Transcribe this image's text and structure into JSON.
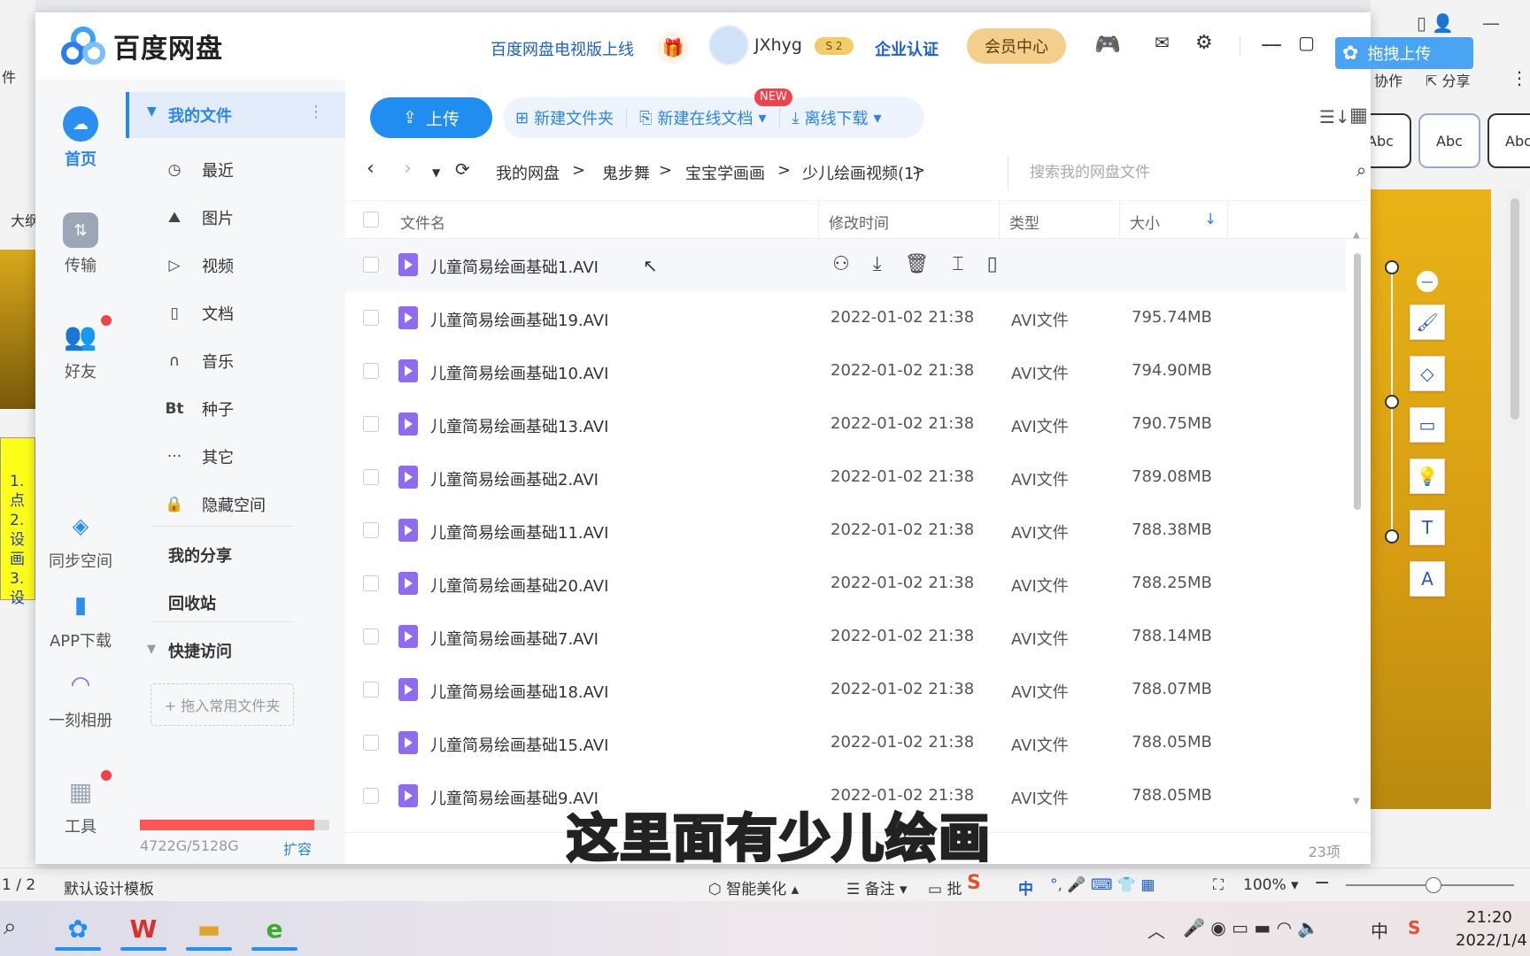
{
  "background_app": {
    "left_labels": [
      "件",
      "大纲"
    ],
    "left_box_lines": [
      "1.点",
      "2.设",
      "画",
      "3.设"
    ],
    "toolbar_right": {
      "collab": "协作",
      "share": "分享"
    },
    "style_samples": [
      "Abc",
      "Abc",
      "Abc"
    ],
    "status": {
      "page": "1 / 2",
      "template": "默认设计模板",
      "beautify": "智能美化",
      "notes": "备注",
      "batch": "批",
      "zoom": "100%"
    }
  },
  "taskbar": {
    "time": "21:20",
    "date": "2022/1/4",
    "ime": [
      "中",
      "中"
    ]
  },
  "baidu": {
    "logo": "百度网盘",
    "tv_link": "百度网盘电视版上线",
    "username": "JXhyg",
    "enterprise": "企业认证",
    "vip_center": "会员中心",
    "drag_upload": "拖拽上传",
    "rail": [
      {
        "label": "首页",
        "icon": "cloud-icon"
      },
      {
        "label": "传输",
        "icon": "transfer-icon"
      },
      {
        "label": "好友",
        "icon": "friends-icon"
      },
      {
        "label": "同步空间",
        "icon": "sync-icon"
      },
      {
        "label": "APP下载",
        "icon": "phone-icon"
      },
      {
        "label": "一刻相册",
        "icon": "album-icon"
      },
      {
        "label": "工具",
        "icon": "tools-icon"
      }
    ],
    "nav": {
      "my_files": "我的文件",
      "items": [
        {
          "label": "最近",
          "icon": "clock-icon"
        },
        {
          "label": "图片",
          "icon": "image-icon"
        },
        {
          "label": "视频",
          "icon": "play-icon"
        },
        {
          "label": "文档",
          "icon": "doc-icon"
        },
        {
          "label": "音乐",
          "icon": "headphone-icon"
        },
        {
          "label": "种子",
          "icon": "bt-icon"
        },
        {
          "label": "其它",
          "icon": "more-icon"
        },
        {
          "label": "隐藏空间",
          "icon": "lock-icon"
        }
      ],
      "my_share": "我的分享",
      "recycle": "回收站",
      "quick_access": "快捷访问",
      "drop_hint": "+ 拖入常用文件夹",
      "storage": "4722G/5128G",
      "storage_used_fraction": 0.92,
      "expand": "扩容"
    },
    "toolbar": {
      "upload": "上传",
      "new_folder": "新建文件夹",
      "new_online_doc": "新建在线文档",
      "new_badge": "NEW",
      "offline_download": "离线下载"
    },
    "breadcrumb": [
      "我的网盘",
      "鬼步舞",
      "宝宝学画画",
      "少儿绘画视频(1)"
    ],
    "search_placeholder": "搜索我的网盘文件",
    "columns": {
      "name": "文件名",
      "modified": "修改时间",
      "type": "类型",
      "size": "大小"
    },
    "files": [
      {
        "name": "儿童简易绘画基础1.AVI",
        "date": "",
        "type": "",
        "size": ""
      },
      {
        "name": "儿童简易绘画基础19.AVI",
        "date": "2022-01-02 21:38",
        "type": "AVI文件",
        "size": "795.74MB"
      },
      {
        "name": "儿童简易绘画基础10.AVI",
        "date": "2022-01-02 21:38",
        "type": "AVI文件",
        "size": "794.90MB"
      },
      {
        "name": "儿童简易绘画基础13.AVI",
        "date": "2022-01-02 21:38",
        "type": "AVI文件",
        "size": "790.75MB"
      },
      {
        "name": "儿童简易绘画基础2.AVI",
        "date": "2022-01-02 21:38",
        "type": "AVI文件",
        "size": "789.08MB"
      },
      {
        "name": "儿童简易绘画基础11.AVI",
        "date": "2022-01-02 21:38",
        "type": "AVI文件",
        "size": "788.38MB"
      },
      {
        "name": "儿童简易绘画基础20.AVI",
        "date": "2022-01-02 21:38",
        "type": "AVI文件",
        "size": "788.25MB"
      },
      {
        "name": "儿童简易绘画基础7.AVI",
        "date": "2022-01-02 21:38",
        "type": "AVI文件",
        "size": "788.14MB"
      },
      {
        "name": "儿童简易绘画基础18.AVI",
        "date": "2022-01-02 21:38",
        "type": "AVI文件",
        "size": "788.07MB"
      },
      {
        "name": "儿童简易绘画基础15.AVI",
        "date": "2022-01-02 21:38",
        "type": "AVI文件",
        "size": "788.05MB"
      },
      {
        "name": "儿童简易绘画基础9.AVI",
        "date": "2022-01-02 21:38",
        "type": "AVI文件",
        "size": "788.05MB"
      }
    ],
    "item_count": "23项"
  },
  "subtitle": "这里面有少儿绘画",
  "colors": {
    "accent": "#1f8ef0",
    "vip": "#f4cf8c",
    "file_icon": "#8e6bf0",
    "subtitle": "#ffe600"
  }
}
